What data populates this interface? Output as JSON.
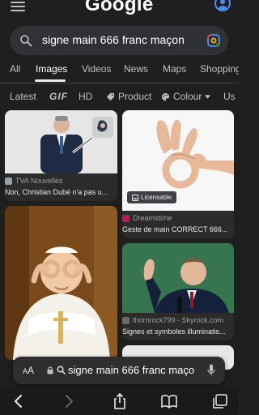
{
  "header": {
    "logo": "Google",
    "menu_icon": "hamburger-menu-icon",
    "account_icon": "account-circle-icon"
  },
  "search": {
    "query": "signe main 666 franc maçon",
    "search_icon": "search-icon",
    "lens_icon": "google-lens-icon"
  },
  "tabs": [
    "All",
    "Images",
    "Videos",
    "News",
    "Maps",
    "Shopping"
  ],
  "active_tab": "Images",
  "filters": {
    "latest": "Latest",
    "gif": "GIF",
    "hd": "HD",
    "product": "Product",
    "colour": "Colour",
    "usage": "Us"
  },
  "results": [
    {
      "source": "TVA Nouvelles",
      "title": "Non, Christian Dubé n'a pas u...",
      "licensable": ""
    },
    {
      "source": "Dreamstime",
      "title": "Geste de main CORRECT 666...",
      "licensable": "Licensable"
    },
    {
      "source": "",
      "title": "",
      "licensable": ""
    },
    {
      "source": "thornrock799 - Skyrock.com",
      "title": "Signes et symboles illuminatis...",
      "licensable": ""
    }
  ],
  "address_bar": {
    "aa_big": "A",
    "aa_small": "A",
    "url_text": "signe main 666 franc maço"
  },
  "colors": {
    "background": "#1f1f1f",
    "surface": "#303134",
    "accent_blue": "#4b8ef7"
  }
}
